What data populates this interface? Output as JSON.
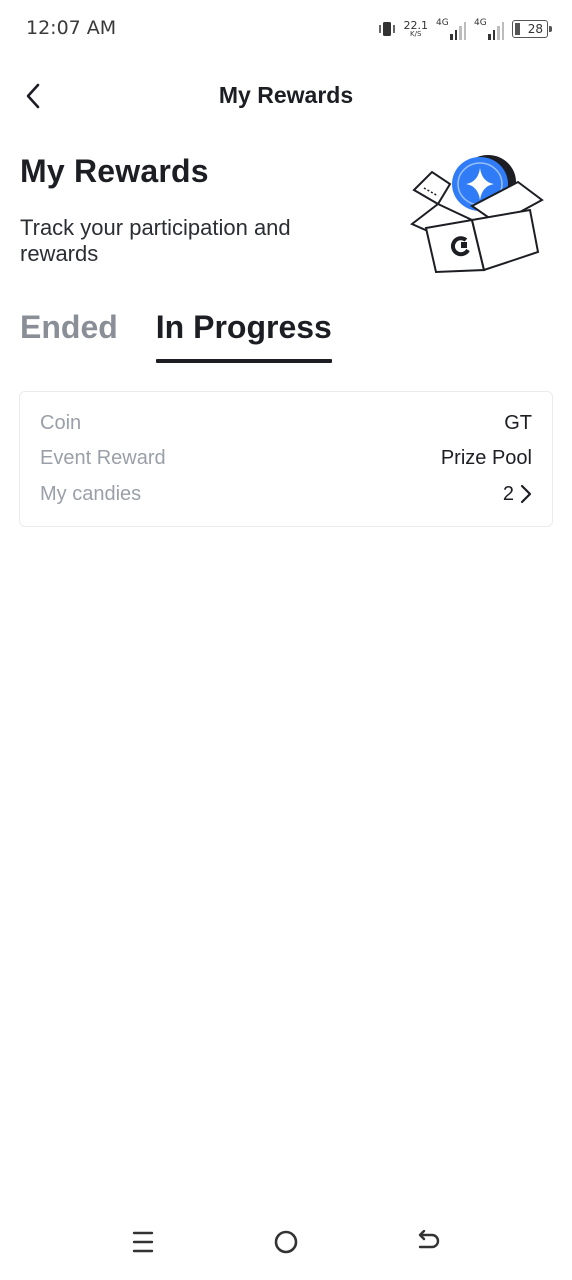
{
  "status_bar": {
    "time": "12:07 AM",
    "net_speed_value": "22.1",
    "net_speed_unit": "K/S",
    "sim1_label": "4G",
    "sim2_label": "4G",
    "battery": "28",
    "icons": [
      "vibrate-icon",
      "signal-icon",
      "signal-icon",
      "battery-icon"
    ]
  },
  "nav": {
    "title": "My Rewards",
    "back_icon": "chevron-left-icon"
  },
  "header": {
    "heading": "My Rewards",
    "subtitle": "Track your participation and rewards",
    "illustration": "gift-box-coin-illustration"
  },
  "tabs": [
    {
      "label": "Ended",
      "active": false
    },
    {
      "label": "In Progress",
      "active": true
    }
  ],
  "card": {
    "rows": [
      {
        "label": "Coin",
        "value": "GT"
      },
      {
        "label": "Event Reward",
        "value": "Prize Pool"
      },
      {
        "label": "My candies",
        "value": "2"
      }
    ]
  },
  "colors": {
    "accent": "#2f7cf6",
    "text_primary": "#1c1e23",
    "text_muted": "#9aa0a8",
    "tab_inactive": "#8a8f97"
  },
  "system_nav": {
    "icons": [
      "menu-icon",
      "home-circle-icon",
      "back-arrow-icon"
    ]
  }
}
